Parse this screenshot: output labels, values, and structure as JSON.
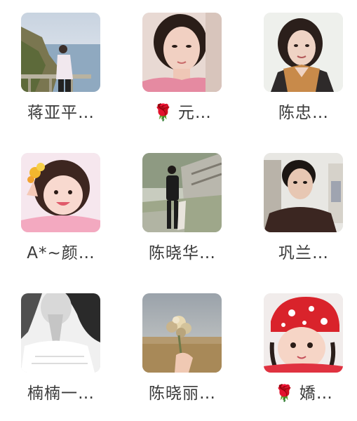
{
  "contacts": [
    {
      "id": "c1",
      "name": "蒋亚平…",
      "prefix": "",
      "avatar_desc": "seaside-photo"
    },
    {
      "id": "c2",
      "name": "元…",
      "prefix": "🌹",
      "avatar_desc": "woman-portrait-pink"
    },
    {
      "id": "c3",
      "name": "陈忠…",
      "prefix": "",
      "avatar_desc": "woman-portrait-coat"
    },
    {
      "id": "c4",
      "name": "A*~颜…",
      "prefix": "",
      "avatar_desc": "child-flowers"
    },
    {
      "id": "c5",
      "name": "陈晓华…",
      "prefix": "",
      "avatar_desc": "man-bridge"
    },
    {
      "id": "c6",
      "name": "巩兰…",
      "prefix": "",
      "avatar_desc": "man-portrait"
    },
    {
      "id": "c7",
      "name": "楠楠一…",
      "prefix": "",
      "avatar_desc": "bw-woman-hands"
    },
    {
      "id": "c8",
      "name": "陈晓丽…",
      "prefix": "",
      "avatar_desc": "bouquet-field"
    },
    {
      "id": "c9",
      "name": "嬌…",
      "prefix": "🌹",
      "avatar_desc": "baby-red-hat"
    }
  ]
}
